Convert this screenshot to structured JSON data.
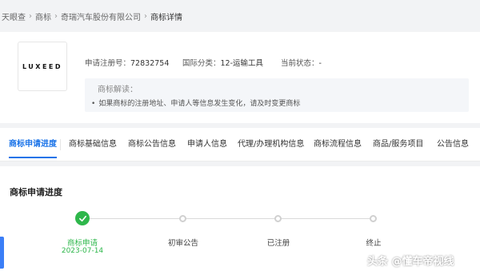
{
  "breadcrumb": [
    "天眼查",
    "商标",
    "奇瑞汽车股份有限公司",
    "商标详情"
  ],
  "logo": {
    "text": "LUXEED"
  },
  "meta": {
    "reg_no_label": "申请注册号：",
    "reg_no": "72832754",
    "intl_class_label": "国际分类：",
    "intl_class": "12-运输工具",
    "status_label": "当前状态：",
    "status": "-"
  },
  "tip": {
    "title": "商标解读：",
    "line": "如果商标的注册地址、申请人等信息发生变化，请及时变更商标"
  },
  "tabs": [
    "商标申请进度",
    "商标基础信息",
    "商标公告信息",
    "申请人信息",
    "代理/办理机构信息",
    "商标流程信息",
    "商品/服务项目",
    "公告信息"
  ],
  "progress": {
    "title": "商标申请进度",
    "steps": [
      {
        "label": "商标申请",
        "date": "2023-07-14",
        "done": true
      },
      {
        "label": "初审公告",
        "done": false
      },
      {
        "label": "已注册",
        "done": false
      },
      {
        "label": "终止",
        "done": false
      }
    ]
  },
  "watermark": "头条 @懂车帝视线",
  "colors": {
    "accent": "#1a73e8",
    "success": "#2eb74b",
    "pending": "#d0d0d0"
  }
}
